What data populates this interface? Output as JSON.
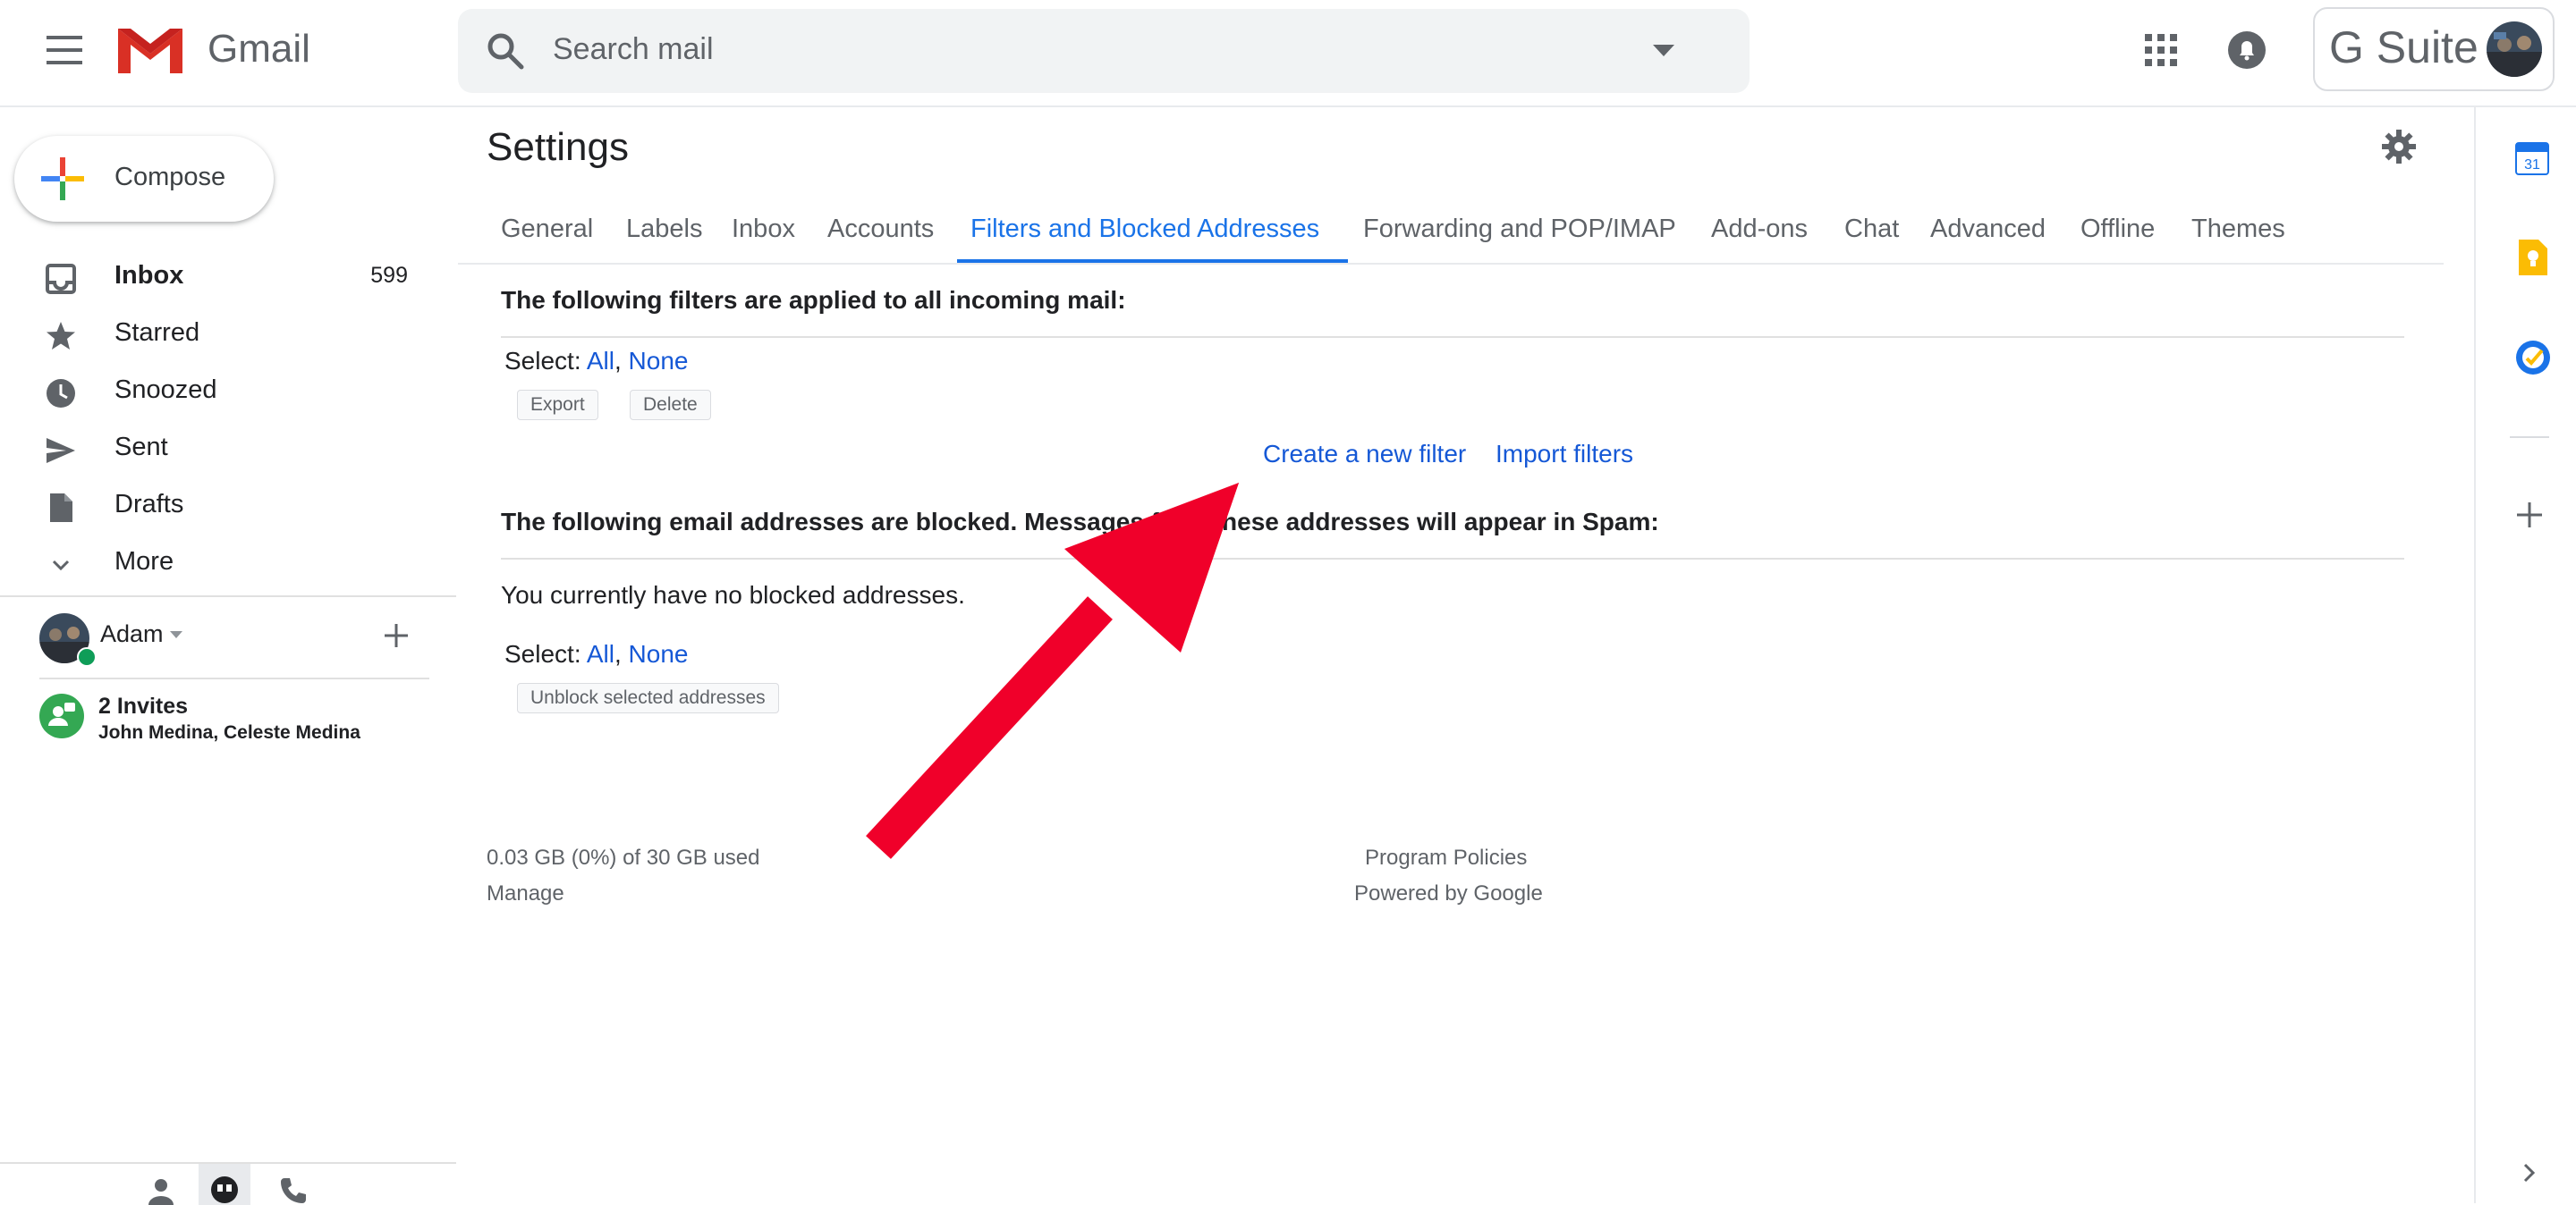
{
  "header": {
    "app_name": "Gmail",
    "search_placeholder": "Search mail",
    "gsuite_label": "G Suite",
    "icons": [
      "menu-icon",
      "gmail-logo",
      "search-icon",
      "dropdown-arrow-icon",
      "apps-grid-icon",
      "notifications-icon"
    ]
  },
  "sidebar": {
    "compose_label": "Compose",
    "items": [
      {
        "label": "Inbox",
        "count": "599",
        "icon": "inbox-icon",
        "bold": true
      },
      {
        "label": "Starred",
        "count": "",
        "icon": "star-icon"
      },
      {
        "label": "Snoozed",
        "count": "",
        "icon": "clock-icon"
      },
      {
        "label": "Sent",
        "count": "",
        "icon": "send-icon"
      },
      {
        "label": "Drafts",
        "count": "",
        "icon": "draft-icon"
      },
      {
        "label": "More",
        "count": "",
        "icon": "chevron-down-icon"
      }
    ],
    "hangouts_user": "Adam",
    "invites_title": "2 Invites",
    "invites_names": "John Medina, Celeste Medina"
  },
  "settings": {
    "title": "Settings",
    "tabs": [
      "General",
      "Labels",
      "Inbox",
      "Accounts",
      "Filters and Blocked Addresses",
      "Forwarding and POP/IMAP",
      "Add-ons",
      "Chat",
      "Advanced",
      "Offline",
      "Themes"
    ],
    "active_tab": "Filters and Blocked Addresses",
    "filters_heading": "The following filters are applied to all incoming mail:",
    "select_label": "Select:",
    "select_all": "All",
    "select_sep": ",",
    "select_none": "None",
    "export_button": "Export",
    "delete_button": "Delete",
    "create_filter_link": "Create a new filter",
    "import_filters_link": "Import filters",
    "blocked_heading": "The following email addresses are blocked. Messages from these addresses will appear in Spam:",
    "no_blocked_text": "You currently have no blocked addresses.",
    "unblock_button": "Unblock selected addresses"
  },
  "footer": {
    "storage_text": "0.03 GB (0%) of 30 GB used",
    "manage_link": "Manage",
    "program_policies": "Program Policies",
    "powered_by": "Powered by Google"
  },
  "addons": {
    "calendar_day": "31",
    "icons": [
      "calendar-icon",
      "keep-icon",
      "tasks-icon",
      "add-addon-icon",
      "expand-panel-icon"
    ]
  },
  "colors": {
    "accent_blue": "#1a73e8",
    "link_blue": "#1558d6",
    "annotation_arrow": "#f0002a",
    "gmail_red": "#d93025"
  }
}
